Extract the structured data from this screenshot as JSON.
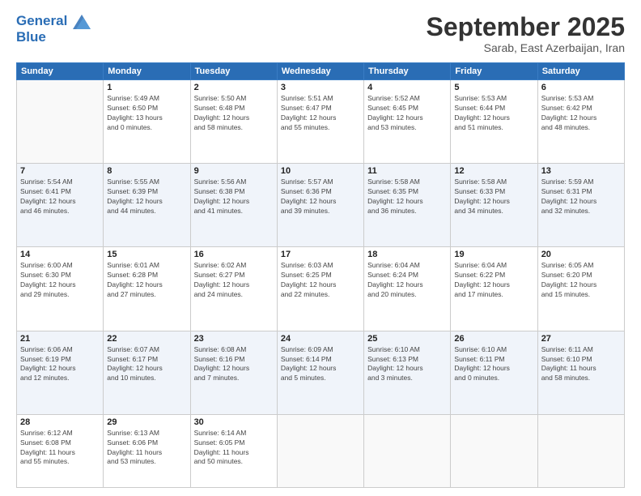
{
  "header": {
    "logo_line1": "General",
    "logo_line2": "Blue",
    "month_year": "September 2025",
    "location": "Sarab, East Azerbaijan, Iran"
  },
  "days_of_week": [
    "Sunday",
    "Monday",
    "Tuesday",
    "Wednesday",
    "Thursday",
    "Friday",
    "Saturday"
  ],
  "weeks": [
    [
      {
        "day": "",
        "info": ""
      },
      {
        "day": "1",
        "info": "Sunrise: 5:49 AM\nSunset: 6:50 PM\nDaylight: 13 hours\nand 0 minutes."
      },
      {
        "day": "2",
        "info": "Sunrise: 5:50 AM\nSunset: 6:48 PM\nDaylight: 12 hours\nand 58 minutes."
      },
      {
        "day": "3",
        "info": "Sunrise: 5:51 AM\nSunset: 6:47 PM\nDaylight: 12 hours\nand 55 minutes."
      },
      {
        "day": "4",
        "info": "Sunrise: 5:52 AM\nSunset: 6:45 PM\nDaylight: 12 hours\nand 53 minutes."
      },
      {
        "day": "5",
        "info": "Sunrise: 5:53 AM\nSunset: 6:44 PM\nDaylight: 12 hours\nand 51 minutes."
      },
      {
        "day": "6",
        "info": "Sunrise: 5:53 AM\nSunset: 6:42 PM\nDaylight: 12 hours\nand 48 minutes."
      }
    ],
    [
      {
        "day": "7",
        "info": "Sunrise: 5:54 AM\nSunset: 6:41 PM\nDaylight: 12 hours\nand 46 minutes."
      },
      {
        "day": "8",
        "info": "Sunrise: 5:55 AM\nSunset: 6:39 PM\nDaylight: 12 hours\nand 44 minutes."
      },
      {
        "day": "9",
        "info": "Sunrise: 5:56 AM\nSunset: 6:38 PM\nDaylight: 12 hours\nand 41 minutes."
      },
      {
        "day": "10",
        "info": "Sunrise: 5:57 AM\nSunset: 6:36 PM\nDaylight: 12 hours\nand 39 minutes."
      },
      {
        "day": "11",
        "info": "Sunrise: 5:58 AM\nSunset: 6:35 PM\nDaylight: 12 hours\nand 36 minutes."
      },
      {
        "day": "12",
        "info": "Sunrise: 5:58 AM\nSunset: 6:33 PM\nDaylight: 12 hours\nand 34 minutes."
      },
      {
        "day": "13",
        "info": "Sunrise: 5:59 AM\nSunset: 6:31 PM\nDaylight: 12 hours\nand 32 minutes."
      }
    ],
    [
      {
        "day": "14",
        "info": "Sunrise: 6:00 AM\nSunset: 6:30 PM\nDaylight: 12 hours\nand 29 minutes."
      },
      {
        "day": "15",
        "info": "Sunrise: 6:01 AM\nSunset: 6:28 PM\nDaylight: 12 hours\nand 27 minutes."
      },
      {
        "day": "16",
        "info": "Sunrise: 6:02 AM\nSunset: 6:27 PM\nDaylight: 12 hours\nand 24 minutes."
      },
      {
        "day": "17",
        "info": "Sunrise: 6:03 AM\nSunset: 6:25 PM\nDaylight: 12 hours\nand 22 minutes."
      },
      {
        "day": "18",
        "info": "Sunrise: 6:04 AM\nSunset: 6:24 PM\nDaylight: 12 hours\nand 20 minutes."
      },
      {
        "day": "19",
        "info": "Sunrise: 6:04 AM\nSunset: 6:22 PM\nDaylight: 12 hours\nand 17 minutes."
      },
      {
        "day": "20",
        "info": "Sunrise: 6:05 AM\nSunset: 6:20 PM\nDaylight: 12 hours\nand 15 minutes."
      }
    ],
    [
      {
        "day": "21",
        "info": "Sunrise: 6:06 AM\nSunset: 6:19 PM\nDaylight: 12 hours\nand 12 minutes."
      },
      {
        "day": "22",
        "info": "Sunrise: 6:07 AM\nSunset: 6:17 PM\nDaylight: 12 hours\nand 10 minutes."
      },
      {
        "day": "23",
        "info": "Sunrise: 6:08 AM\nSunset: 6:16 PM\nDaylight: 12 hours\nand 7 minutes."
      },
      {
        "day": "24",
        "info": "Sunrise: 6:09 AM\nSunset: 6:14 PM\nDaylight: 12 hours\nand 5 minutes."
      },
      {
        "day": "25",
        "info": "Sunrise: 6:10 AM\nSunset: 6:13 PM\nDaylight: 12 hours\nand 3 minutes."
      },
      {
        "day": "26",
        "info": "Sunrise: 6:10 AM\nSunset: 6:11 PM\nDaylight: 12 hours\nand 0 minutes."
      },
      {
        "day": "27",
        "info": "Sunrise: 6:11 AM\nSunset: 6:10 PM\nDaylight: 11 hours\nand 58 minutes."
      }
    ],
    [
      {
        "day": "28",
        "info": "Sunrise: 6:12 AM\nSunset: 6:08 PM\nDaylight: 11 hours\nand 55 minutes."
      },
      {
        "day": "29",
        "info": "Sunrise: 6:13 AM\nSunset: 6:06 PM\nDaylight: 11 hours\nand 53 minutes."
      },
      {
        "day": "30",
        "info": "Sunrise: 6:14 AM\nSunset: 6:05 PM\nDaylight: 11 hours\nand 50 minutes."
      },
      {
        "day": "",
        "info": ""
      },
      {
        "day": "",
        "info": ""
      },
      {
        "day": "",
        "info": ""
      },
      {
        "day": "",
        "info": ""
      }
    ]
  ]
}
